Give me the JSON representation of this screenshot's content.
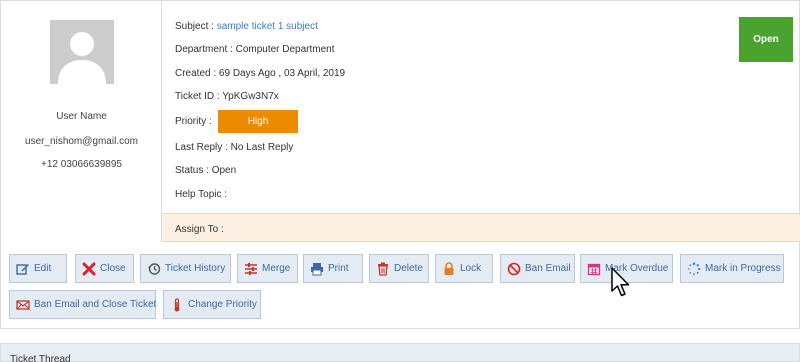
{
  "user": {
    "name": "User Name",
    "email": "user_nishom@gmail.com",
    "phone": "+12 03066639895"
  },
  "ticket": {
    "subject_label": "Subject :",
    "subject_value": "sample ticket 1 subject",
    "department_label": "Department :",
    "department_value": "Computer Department",
    "created_label": "Created :",
    "created_value": "69 Days Ago , 03 April, 2019",
    "id_label": "Ticket ID :",
    "id_value": "YpKGw3N7x",
    "priority_label": "Priority :",
    "priority_value": "High",
    "last_reply_label": "Last Reply :",
    "last_reply_value": "No Last Reply",
    "status_label": "Status :",
    "status_value": "Open",
    "help_topic_label": "Help Topic :",
    "help_topic_value": "",
    "assign_label": "Assign To :",
    "status_badge": "Open"
  },
  "colors": {
    "priority_high": "#ec8b00",
    "status_open": "#4aa32f",
    "link": "#3b7dc4",
    "button_bg": "#e4ebf3",
    "assign_bg": "#fdf0e2"
  },
  "actions": [
    {
      "label": "Edit",
      "icon": "edit-icon"
    },
    {
      "label": "Close",
      "icon": "close-icon"
    },
    {
      "label": "Ticket History",
      "icon": "history-icon"
    },
    {
      "label": "Merge",
      "icon": "merge-icon"
    },
    {
      "label": "Print",
      "icon": "print-icon"
    },
    {
      "label": "Delete",
      "icon": "trash-icon"
    },
    {
      "label": "Lock",
      "icon": "lock-icon"
    },
    {
      "label": "Ban Email",
      "icon": "ban-icon"
    },
    {
      "label": "Mark Overdue",
      "icon": "calendar-icon"
    },
    {
      "label": "Mark in Progress",
      "icon": "spinner-icon"
    },
    {
      "label": "Ban Email and Close Ticket",
      "icon": "envelope-x-icon"
    },
    {
      "label": "Change Priority",
      "icon": "thermometer-icon"
    }
  ],
  "thread_title": "Ticket Thread"
}
